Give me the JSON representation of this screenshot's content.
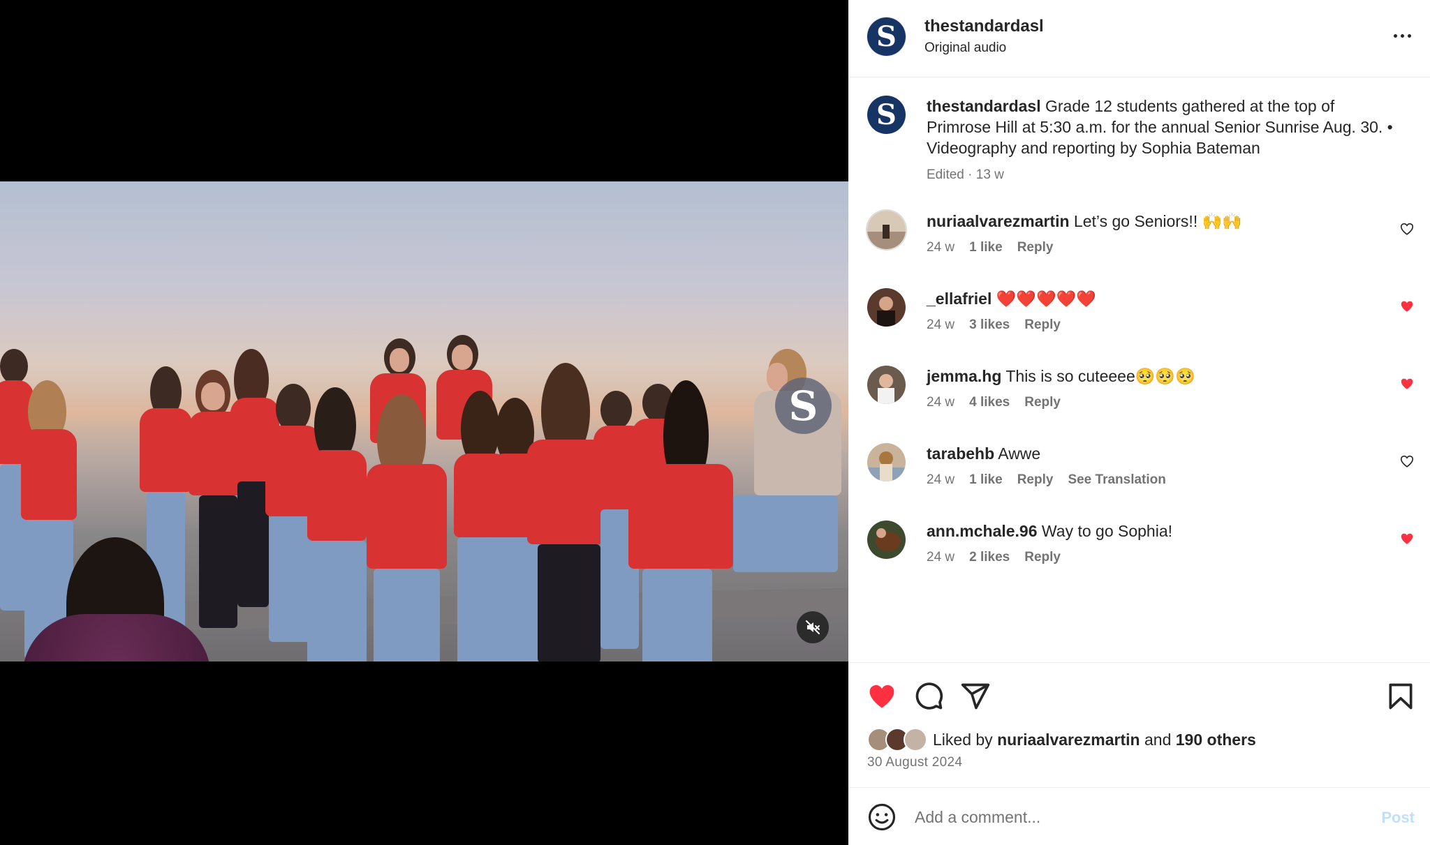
{
  "video": {
    "watermark_letter": "S",
    "mute_icon": "speaker-muted-icon"
  },
  "header": {
    "avatar_letter": "S",
    "username": "thestandardasl",
    "audio": "Original audio",
    "more_icon": "more-horizontal-icon"
  },
  "caption": {
    "avatar_letter": "S",
    "username": "thestandardasl",
    "text": "Grade 12 students gathered at the top of Primrose Hill at 5:30 a.m. for the annual Senior Sunrise Aug. 30. • Videography and reporting by Sophia Bateman",
    "meta": "Edited · 13 w"
  },
  "comments": [
    {
      "username": "nuriaalvarezmartin",
      "text": "Let’s go Seniors!! 🙌🙌",
      "age": "24 w",
      "likes": "1 like",
      "reply": "Reply",
      "extra": "",
      "liked": false
    },
    {
      "username": "_ellafriel",
      "text": "❤️❤️❤️❤️❤️",
      "age": "24 w",
      "likes": "3 likes",
      "reply": "Reply",
      "extra": "",
      "liked": true
    },
    {
      "username": "jemma.hg",
      "text": "This is so cuteeee🥺🥺🥺",
      "age": "24 w",
      "likes": "4 likes",
      "reply": "Reply",
      "extra": "",
      "liked": true
    },
    {
      "username": "tarabehb",
      "text": "Awwe",
      "age": "24 w",
      "likes": "1 like",
      "reply": "Reply",
      "extra": "See Translation",
      "liked": false
    },
    {
      "username": "ann.mchale.96",
      "text": "Way to go Sophia!",
      "age": "24 w",
      "likes": "2 likes",
      "reply": "Reply",
      "extra": "",
      "liked": true
    }
  ],
  "actions": {
    "like_icon": "heart-filled-icon",
    "comment_icon": "comment-bubble-icon",
    "share_icon": "paper-plane-icon",
    "save_icon": "bookmark-icon"
  },
  "likes_summary": {
    "prefix": "Liked by",
    "user": "nuriaalvarezmartin",
    "conj": "and",
    "others": "190 others"
  },
  "post_date": "30 August 2024",
  "comment_box": {
    "placeholder": "Add a comment...",
    "post_label": "Post"
  },
  "colors": {
    "accent_red": "#ff3040",
    "brand_navy": "#173564",
    "post_disabled": "#c0dffd",
    "secondary_text": "#737373"
  }
}
